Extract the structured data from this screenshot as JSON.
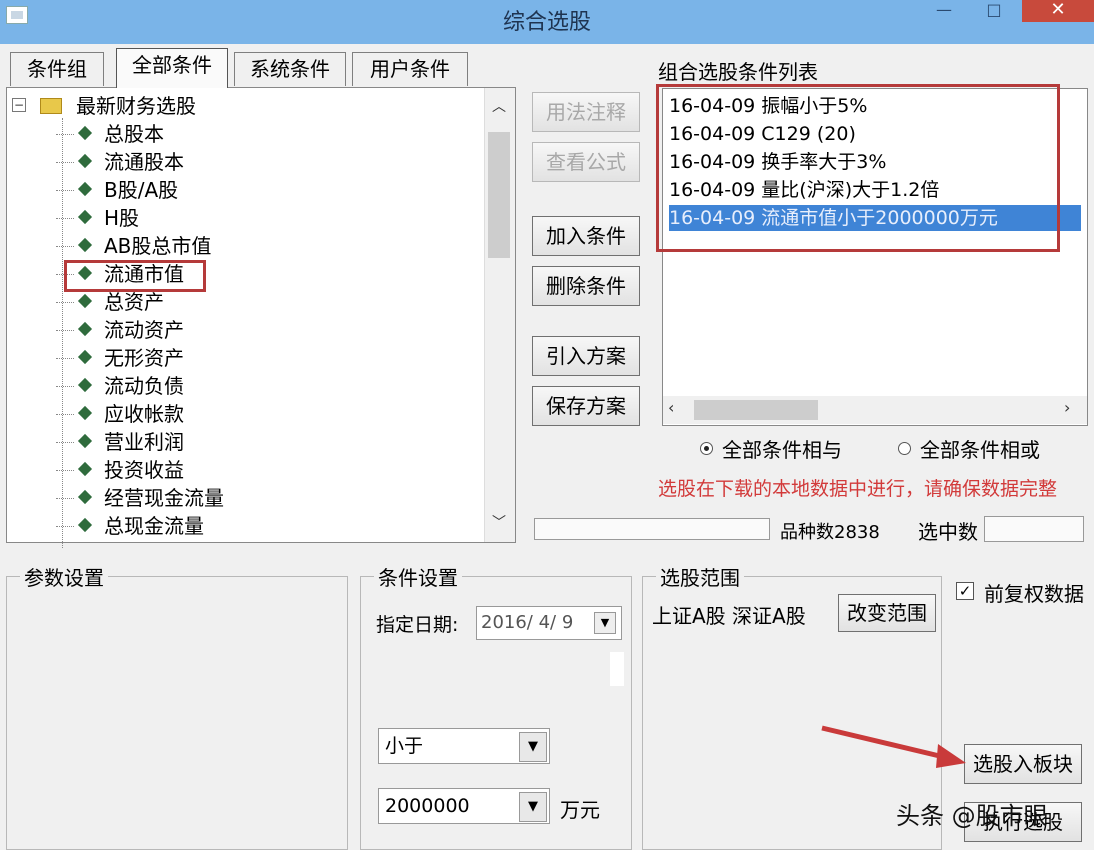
{
  "window": {
    "title": "综合选股",
    "minimize": "—",
    "maximize": "□",
    "close": "✕"
  },
  "tabs": [
    {
      "label": "条件组"
    },
    {
      "label": "全部条件"
    },
    {
      "label": "系统条件"
    },
    {
      "label": "用户条件"
    }
  ],
  "tree": {
    "root": "最新财务选股",
    "items": [
      "总股本",
      "流通股本",
      "B股/A股",
      "H股",
      "AB股总市值",
      "流通市值",
      "总资产",
      "流动资产",
      "无形资产",
      "流动负债",
      "应收帐款",
      "营业利润",
      "投资收益",
      "经营现金流量",
      "总现金流量"
    ],
    "selected": "流通市值"
  },
  "buttons": {
    "usage": "用法注释",
    "formula": "查看公式",
    "add": "加入条件",
    "delete": "删除条件",
    "import": "引入方案",
    "save": "保存方案"
  },
  "condition_list": {
    "title": "组合选股条件列表",
    "items": [
      "16-04-09 振幅小于5%",
      "16-04-09 C129 (20)",
      "16-04-09 换手率大于3%",
      "16-04-09 量比(沪深)大于1.2倍",
      "16-04-09 流通市值小于2000000万元"
    ],
    "selected_index": 4
  },
  "logic": {
    "and_label": "全部条件相与",
    "or_label": "全部条件相或",
    "selected": "and"
  },
  "note": "选股在下载的本地数据中进行，请确保数据完整",
  "status": {
    "species": "品种数2838",
    "selected_label": "选中数"
  },
  "params": {
    "title": "参数设置"
  },
  "cond_settings": {
    "title": "条件设置",
    "date_label": "指定日期:",
    "date_value": "2016/ 4/ 9",
    "operator": "小于",
    "value": "2000000",
    "unit": "万元"
  },
  "range": {
    "title": "选股范围",
    "text": "上证A股 深证A股",
    "button": "改变范围"
  },
  "options": {
    "adjust_label": "前复权数据",
    "adjust_checked": true
  },
  "actions": {
    "select_into": "选股入板块",
    "execute": "执行选股"
  },
  "watermark": "头条 @股市眼",
  "colors": {
    "titlebar": "#7ab4e8",
    "highlight_red": "#b53a3a",
    "selection_blue": "#3f84d6",
    "note_red": "#d23a3a"
  }
}
